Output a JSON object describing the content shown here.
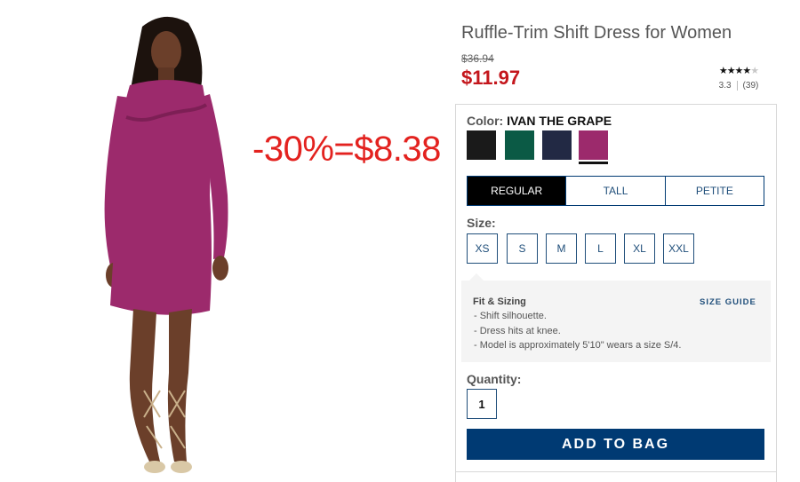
{
  "promo": {
    "text": "-30%=$8.38"
  },
  "product": {
    "title": "Ruffle-Trim Shift Dress for Women",
    "original_price": "$36.94",
    "sale_price": "$11.97",
    "rating": {
      "value": "3.3",
      "count": "(39)",
      "stars_out_of_5": 3.3
    }
  },
  "color": {
    "label": "Color:",
    "selected": "IVAN THE GRAPE",
    "swatches": [
      {
        "name": "black",
        "hex": "#1a1a1a"
      },
      {
        "name": "green",
        "hex": "#0b5a45"
      },
      {
        "name": "navy",
        "hex": "#222944"
      },
      {
        "name": "grape",
        "hex": "#9c2a6c",
        "selected": true
      }
    ]
  },
  "fit_tabs": {
    "items": [
      "REGULAR",
      "TALL",
      "PETITE"
    ],
    "active": "REGULAR"
  },
  "size": {
    "label": "Size:",
    "options": [
      "XS",
      "S",
      "M",
      "L",
      "XL",
      "XXL"
    ]
  },
  "fit_sizing": {
    "title": "Fit & Sizing",
    "guide_link": "SIZE GUIDE",
    "lines": [
      "-  Shift silhouette.",
      "-  Dress hits at knee.",
      "-  Model is approximately 5'10\" wears a size S/4."
    ]
  },
  "quantity": {
    "label": "Quantity:",
    "value": "1"
  },
  "cart": {
    "add_label": "ADD TO BAG"
  },
  "colors": {
    "sale": "#c4161c",
    "promo": "#e3221f",
    "primary": "#003a73",
    "dress": "#9c2a6c"
  }
}
